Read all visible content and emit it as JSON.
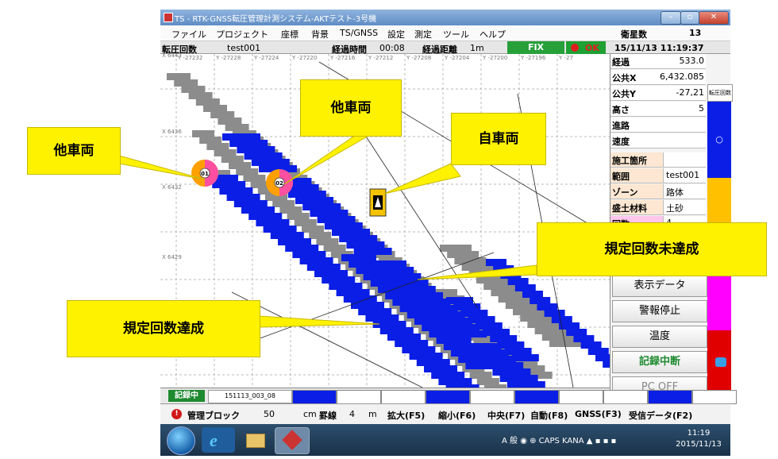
{
  "window": {
    "title": "TS - RTK-GNSS転圧管理計測システム-AKTテスト-3号機",
    "min": "–",
    "max": "▫",
    "close": "✕"
  },
  "menu": {
    "items": [
      "ファイル",
      "プロジェクト",
      "座標",
      "背景",
      "TS/GNSS",
      "設定",
      "測定",
      "ツール",
      "ヘルプ"
    ],
    "satellites_label": "衛星数",
    "satellites_value": "13"
  },
  "status": {
    "mode": "転圧回数",
    "project": "test001",
    "elapsed_time_label": "経過時間",
    "elapsed_time": "00:08",
    "elapsed_distance_label": "経過距離",
    "elapsed_distance": "1m",
    "fix": "FIX",
    "ok": "OK",
    "datetime": "15/11/13 11:19:37"
  },
  "map": {
    "x_labels": [
      "X 6443",
      "X 6436",
      "X 6432",
      "X 6429"
    ],
    "y_labels": [
      "Y -27232",
      "Y -27228",
      "Y -27224",
      "Y -27220",
      "Y -27216",
      "Y -27212",
      "Y -27208",
      "Y -27204",
      "Y -27200",
      "Y -27196",
      "Y -27"
    ],
    "marker1": "01",
    "marker2": "02",
    "colors": {
      "unreached": "#8c8c8c",
      "reached": "#0a1ee6",
      "other_vehicle": "#ff4fa0",
      "other_vehicle_ring": "#ffa000"
    }
  },
  "panel": {
    "rows": [
      {
        "label": "経過",
        "value": "533.0"
      },
      {
        "label": "公共X",
        "value": "6,432.085"
      },
      {
        "label": "公共Y",
        "value": "-27,21"
      },
      {
        "label": "高さ",
        "value": "5"
      },
      {
        "label": "進路",
        "value": ""
      },
      {
        "label": "速度",
        "value": ""
      }
    ],
    "info_rows": [
      {
        "label": "施工箇所",
        "value": ""
      },
      {
        "label": "範囲",
        "value": "test001"
      },
      {
        "label": "ゾーン",
        "value": "路体"
      },
      {
        "label": "盛土材料",
        "value": "土砂"
      },
      {
        "label": "回数",
        "value": "4"
      }
    ],
    "buttons": [
      "表示データ",
      "警報停止",
      "温度",
      "記録中断",
      "PC OFF"
    ],
    "side_tab": "転圧回数",
    "side_circle": "○"
  },
  "bottom": {
    "recording": "記録中",
    "file": "151113_003_08"
  },
  "commands": {
    "block_label": "管理ブロック",
    "block_value": "50",
    "unit_cm": "cm",
    "grid_label": "罫線",
    "grid_value": "4",
    "unit_m": "m",
    "zoom_in": "拡大(F5)",
    "zoom_out": "縮小(F6)",
    "center": "中央(F7)",
    "auto": "自動(F8)",
    "gnss": "GNSS(F3)",
    "receive": "受信データ(F2)"
  },
  "taskbar": {
    "tray": "A 般 ◉ ⊕ CAPS KANA ▲ ▪ ▪ ▪",
    "time": "11:19",
    "date": "2015/11/13"
  },
  "callouts": {
    "other_vehicle_left": "他車両",
    "other_vehicle_top": "他車両",
    "own_vehicle": "自車両",
    "not_reached": "規定回数未達成",
    "reached": "規定回数達成"
  }
}
